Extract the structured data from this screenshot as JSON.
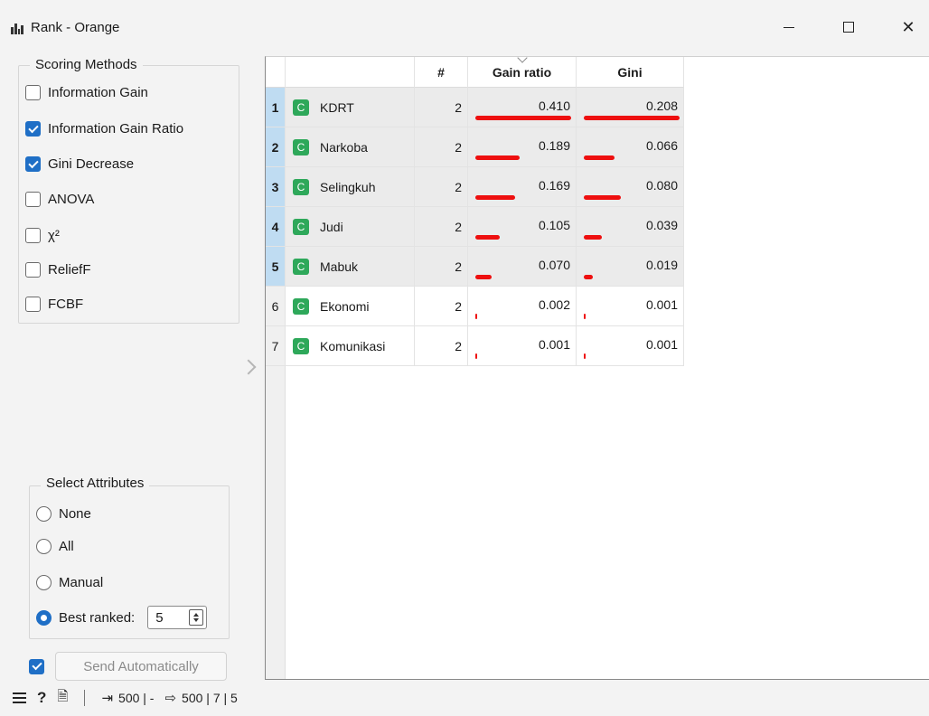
{
  "window": {
    "title": "Rank - Orange",
    "minimize_icon": "minimize-icon",
    "maximize_icon": "maximize-icon",
    "close_icon": "close-icon",
    "close_glyph": "✕"
  },
  "scoring": {
    "title": "Scoring Methods",
    "methods": [
      {
        "label": "Information Gain",
        "checked": false
      },
      {
        "label": "Information Gain Ratio",
        "checked": true
      },
      {
        "label": "Gini Decrease",
        "checked": true
      },
      {
        "label": "ANOVA",
        "checked": false
      },
      {
        "label": "χ²",
        "checked": false
      },
      {
        "label": "ReliefF",
        "checked": false
      },
      {
        "label": "FCBF",
        "checked": false
      }
    ]
  },
  "select": {
    "title": "Select Attributes",
    "options": [
      {
        "label": "None",
        "checked": false
      },
      {
        "label": "All",
        "checked": false
      },
      {
        "label": "Manual",
        "checked": false
      },
      {
        "label": "Best ranked:",
        "checked": true
      }
    ],
    "best_ranked_value": "5"
  },
  "send": {
    "auto_checked": true,
    "label": "Send Automatically"
  },
  "table": {
    "headers": {
      "hash": "#",
      "gain_ratio": "Gain ratio",
      "gini": "Gini"
    },
    "badge": "C",
    "max_gain_ratio": 0.41,
    "max_gini": 0.208,
    "rows": [
      {
        "idx": "1",
        "name": "KDRT",
        "count": "2",
        "gain_ratio": "0.410",
        "gini": "0.208",
        "selected": true
      },
      {
        "idx": "2",
        "name": "Narkoba",
        "count": "2",
        "gain_ratio": "0.189",
        "gini": "0.066",
        "selected": true
      },
      {
        "idx": "3",
        "name": "Selingkuh",
        "count": "2",
        "gain_ratio": "0.169",
        "gini": "0.080",
        "selected": true
      },
      {
        "idx": "4",
        "name": "Judi",
        "count": "2",
        "gain_ratio": "0.105",
        "gini": "0.039",
        "selected": true
      },
      {
        "idx": "5",
        "name": "Mabuk",
        "count": "2",
        "gain_ratio": "0.070",
        "gini": "0.019",
        "selected": true
      },
      {
        "idx": "6",
        "name": "Ekonomi",
        "count": "2",
        "gain_ratio": "0.002",
        "gini": "0.001",
        "selected": false
      },
      {
        "idx": "7",
        "name": "Komunikasi",
        "count": "2",
        "gain_ratio": "0.001",
        "gini": "0.001",
        "selected": false
      }
    ]
  },
  "status": {
    "input_text": "500 | -",
    "output_text": "500 | 7 | 5",
    "help_glyph": "?",
    "doc_glyph": "🗎",
    "input_glyph": "⇥",
    "output_glyph": "⇨"
  },
  "colors": {
    "accent": "#1f6fc6",
    "bar": "#ee0f0f",
    "badge": "#2ea85a",
    "row_selected": "#bfdcf2"
  }
}
